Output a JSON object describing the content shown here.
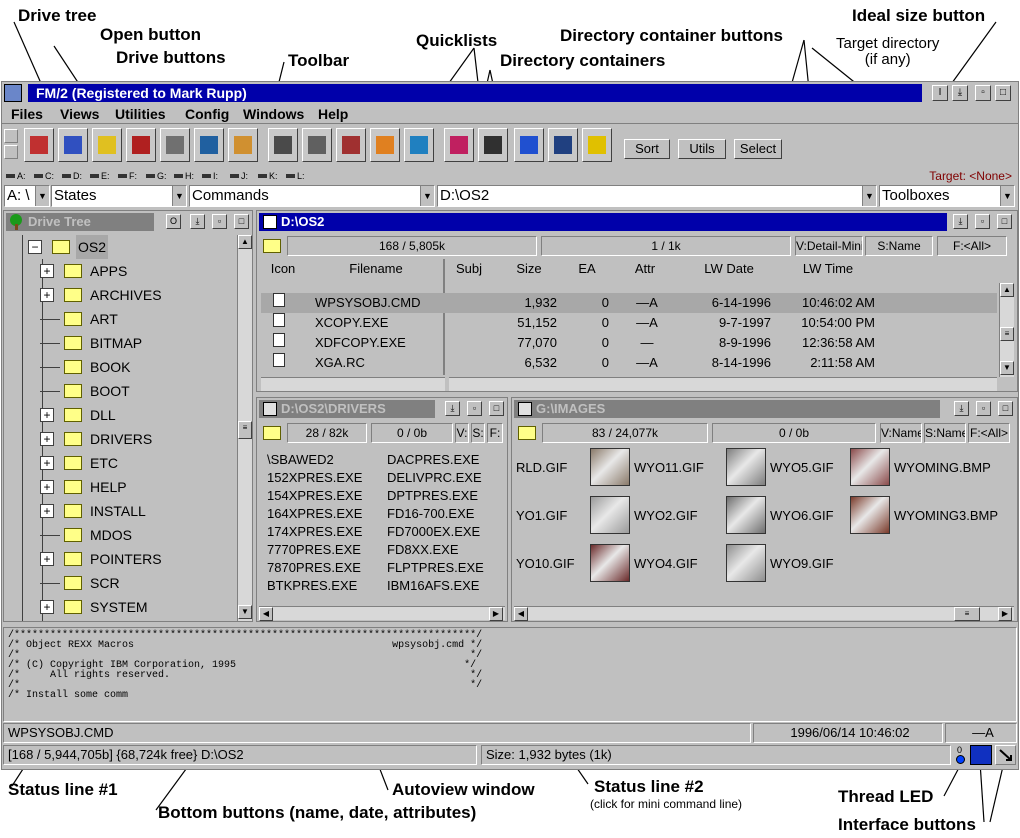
{
  "annotations": {
    "drive_tree": "Drive tree",
    "open_button": "Open button",
    "drive_buttons": "Drive buttons",
    "toolbar": "Toolbar",
    "quicklists": "Quicklists",
    "directory_container_buttons": "Directory container buttons",
    "directory_containers": "Directory containers",
    "ideal_size_button": "Ideal size button",
    "target_directory": "Target directory\n(if any)",
    "status_line_1": "Status line #1",
    "bottom_buttons": "Bottom buttons (name, date, attributes)",
    "autoview_window": "Autoview window",
    "status_line_2": "Status line #2",
    "status_line_2_note": "(click for mini command line)",
    "thread_led": "Thread LED",
    "interface_buttons": "Interface buttons"
  },
  "window": {
    "title": "FM/2  (Registered to Mark Rupp)",
    "ideal_size_glyph": "I"
  },
  "menu": [
    "Files",
    "Views",
    "Utilities",
    "Config",
    "Windows",
    "Help"
  ],
  "toolbar": {
    "icons": [
      "eye-icon",
      "info-icon",
      "help-question-icon",
      "delete-trash-icon",
      "attributes-icon",
      "drive-icon",
      "move-truck-icon",
      "compare-icon",
      "box-icon",
      "door-icon",
      "basket-icon",
      "palette-icon",
      "sweep-icon",
      "cube-icon",
      "windows-icon",
      "settings-icon",
      "question-icon"
    ],
    "sort_label": "Sort",
    "utils_label": "Utils",
    "select_label": "Select"
  },
  "drives": [
    "A:",
    "C:",
    "D:",
    "E:",
    "F:",
    "G:",
    "H:",
    "I:",
    "J:",
    "K:",
    "L:"
  ],
  "target": "Target: <None>",
  "quicklists": {
    "drive": "A: \\",
    "states": "States",
    "commands": "Commands",
    "path": "D:\\OS2",
    "toolboxes": "Toolboxes"
  },
  "tree": {
    "title": "Drive Tree",
    "open_glyph": "O",
    "items": [
      {
        "label": "OS2",
        "expand": "−",
        "level": 0,
        "selected": true
      },
      {
        "label": "APPS",
        "expand": "+",
        "level": 1
      },
      {
        "label": "ARCHIVES",
        "expand": "+",
        "level": 1
      },
      {
        "label": "ART",
        "expand": "",
        "level": 1
      },
      {
        "label": "BITMAP",
        "expand": "",
        "level": 1
      },
      {
        "label": "BOOK",
        "expand": "",
        "level": 1
      },
      {
        "label": "BOOT",
        "expand": "",
        "level": 1
      },
      {
        "label": "DLL",
        "expand": "+",
        "level": 1
      },
      {
        "label": "DRIVERS",
        "expand": "+",
        "level": 1
      },
      {
        "label": "ETC",
        "expand": "+",
        "level": 1
      },
      {
        "label": "HELP",
        "expand": "+",
        "level": 1
      },
      {
        "label": "INSTALL",
        "expand": "+",
        "level": 1
      },
      {
        "label": "MDOS",
        "expand": "",
        "level": 1
      },
      {
        "label": "POINTERS",
        "expand": "+",
        "level": 1
      },
      {
        "label": "SCR",
        "expand": "",
        "level": 1
      },
      {
        "label": "SYSTEM",
        "expand": "+",
        "level": 1
      }
    ]
  },
  "main_dir": {
    "title": "D:\\OS2",
    "count": "168 / 5,805k",
    "selected": "1 / 1k",
    "view_btn": "V:Detail-Mini",
    "sort_btn": "S:Name",
    "filter_btn": "F:<All>",
    "columns": [
      "Icon",
      "Filename",
      "Subj",
      "Size",
      "EA",
      "Attr",
      "LW Date",
      "LW Time"
    ],
    "rows": [
      {
        "name": "WPSYSOBJ.CMD",
        "size": "1,932",
        "ea": "0",
        "attr": "—A",
        "date": "6-14-1996",
        "time": "10:46:02 AM",
        "selected": true
      },
      {
        "name": "XCOPY.EXE",
        "size": "51,152",
        "ea": "0",
        "attr": "—A",
        "date": "9-7-1997",
        "time": "10:54:00 PM"
      },
      {
        "name": "XDFCOPY.EXE",
        "size": "77,070",
        "ea": "0",
        "attr": "—",
        "date": "8-9-1996",
        "time": "12:36:58 AM"
      },
      {
        "name": "XGA.RC",
        "size": "6,532",
        "ea": "0",
        "attr": "—A",
        "date": "8-14-1996",
        "time": "2:11:58 AM"
      }
    ]
  },
  "drivers_dir": {
    "title": "D:\\OS2\\DRIVERS",
    "count": "28 / 82k",
    "selected": "0 / 0b",
    "btn_v": "V:",
    "btn_s": "S:",
    "btn_f": "F:",
    "col1": [
      "\\SBAWED2",
      "152XPRES.EXE",
      "154XPRES.EXE",
      "164XPRES.EXE",
      "174XPRES.EXE",
      "7770PRES.EXE",
      "7870PRES.EXE",
      "BTKPRES.EXE"
    ],
    "col2": [
      "DACPRES.EXE",
      "DELIVPRC.EXE",
      "DPTPRES.EXE",
      "FD16-700.EXE",
      "FD7000EX.EXE",
      "FD8XX.EXE",
      "FLPTPRES.EXE",
      "IBM16AFS.EXE"
    ]
  },
  "images_dir": {
    "title": "G:\\IMAGES",
    "count": "83 / 24,077k",
    "selected": "0 / 0b",
    "view_btn": "V:Name",
    "sort_btn": "S:Name",
    "filter_btn": "F:<All>",
    "items": [
      {
        "name": "RLD.GIF",
        "thumb": false
      },
      {
        "name": "WYO11.GIF",
        "thumb": true,
        "color": "#8a7a6a"
      },
      {
        "name": "WYO5.GIF",
        "thumb": true,
        "color": "#7d7d7d"
      },
      {
        "name": "WYOMING.BMP",
        "thumb": true,
        "color": "#8a4a4a"
      },
      {
        "name": "YO1.GIF",
        "thumb": false
      },
      {
        "name": "WYO2.GIF",
        "thumb": true,
        "color": "#9a9a9a"
      },
      {
        "name": "WYO6.GIF",
        "thumb": true,
        "color": "#6e6e6e"
      },
      {
        "name": "WYOMING3.BMP",
        "thumb": true,
        "color": "#7a3a2a"
      },
      {
        "name": "YO10.GIF",
        "thumb": false
      },
      {
        "name": "WYO4.GIF",
        "thumb": true,
        "color": "#6a2a2a"
      },
      {
        "name": "WYO9.GIF",
        "thumb": true,
        "color": "#8e8e8e"
      }
    ]
  },
  "autoview": {
    "text": "/*****************************************************************************/\n/* Object REXX Macros                                           wpsysobj.cmd */\n/*                                                                           */\n/* (C) Copyright IBM Corporation, 1995                                      */\n/*     All rights reserved.                                                  */\n/*                                                                           */\n/* Install some comm"
  },
  "bottom_buttons": {
    "name": "WPSYSOBJ.CMD",
    "date": "1996/06/14 10:46:02",
    "attr": "—A"
  },
  "status": {
    "line1": "[168 / 5,944,705b]  {68,724k free}  D:\\OS2",
    "line2": "Size:  1,932 bytes (1k)",
    "led_count": "0"
  },
  "colors": {
    "title_active": "#0000aa",
    "window_bg": "#c0c0c0",
    "target_text": "#800000"
  }
}
